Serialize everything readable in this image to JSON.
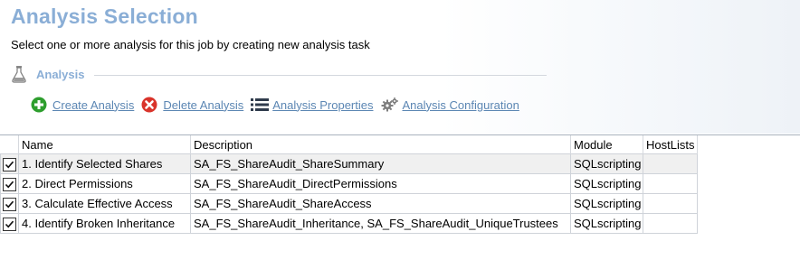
{
  "page": {
    "title": "Analysis Selection",
    "subtitle": "Select one or more analysis for this job by creating new analysis task"
  },
  "section": {
    "title": "Analysis",
    "icon": "flask-icon"
  },
  "toolbar": {
    "create_label": "Create Analysis",
    "delete_label": "Delete Analysis",
    "properties_label": "Analysis Properties",
    "configuration_label": "Analysis Configuration",
    "create_icon": "plus-circle-icon",
    "delete_icon": "x-circle-icon",
    "properties_icon": "list-icon",
    "configuration_icon": "gears-icon",
    "create_color": "#2e9e2e",
    "delete_color": "#d9342b"
  },
  "grid": {
    "columns": [
      "Name",
      "Description",
      "Module",
      "HostLists"
    ],
    "rows": [
      {
        "checked": true,
        "name": "1. Identify Selected Shares",
        "description": "SA_FS_ShareAudit_ShareSummary",
        "module": "SQLscripting",
        "hostlists": ""
      },
      {
        "checked": true,
        "name": "2. Direct Permissions",
        "description": "SA_FS_ShareAudit_DirectPermissions",
        "module": "SQLscripting",
        "hostlists": ""
      },
      {
        "checked": true,
        "name": "3. Calculate Effective Access",
        "description": "SA_FS_ShareAudit_ShareAccess",
        "module": "SQLscripting",
        "hostlists": ""
      },
      {
        "checked": true,
        "name": "4. Identify Broken Inheritance",
        "description": "SA_FS_ShareAudit_Inheritance, SA_FS_ShareAudit_UniqueTrustees",
        "module": "SQLscripting",
        "hostlists": ""
      }
    ]
  },
  "colors": {
    "title": "#8aaed6",
    "link": "#5b86b3",
    "selected_row": "#f0f0f0"
  }
}
